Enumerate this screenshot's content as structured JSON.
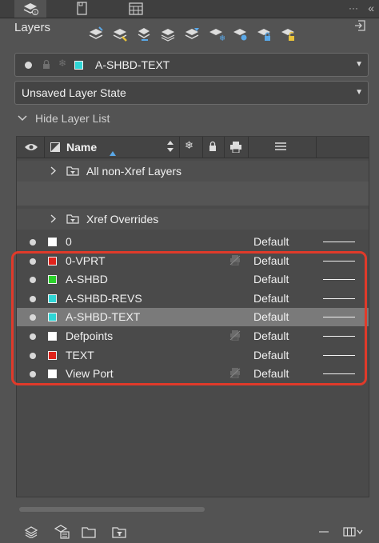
{
  "panel": {
    "title": "Layers",
    "current_layer": "A-SHBD-TEXT",
    "current_layer_color": "#2fd6d6",
    "layer_state": "Unsaved Layer State",
    "hide_list_label": "Hide Layer List",
    "overflow_glyph": "···",
    "collapse_glyph": "«"
  },
  "columns": {
    "name": "Name"
  },
  "groups": [
    {
      "label": "All non-Xref Layers"
    },
    {
      "label": "Xref Overrides"
    }
  ],
  "layers": [
    {
      "name": "0",
      "color": "#ffffff",
      "linetype": "Default",
      "no_plot": false,
      "selected": false
    },
    {
      "name": "0-VPRT",
      "color": "#e0231b",
      "linetype": "Default",
      "no_plot": true,
      "selected": false
    },
    {
      "name": "A-SHBD",
      "color": "#2bd12b",
      "linetype": "Default",
      "no_plot": false,
      "selected": false
    },
    {
      "name": "A-SHBD-REVS",
      "color": "#2fd6d6",
      "linetype": "Default",
      "no_plot": false,
      "selected": false
    },
    {
      "name": "A-SHBD-TEXT",
      "color": "#2fd6d6",
      "linetype": "Default",
      "no_plot": false,
      "selected": true
    },
    {
      "name": "Defpoints",
      "color": "#ffffff",
      "linetype": "Default",
      "no_plot": true,
      "selected": false
    },
    {
      "name": "TEXT",
      "color": "#e0231b",
      "linetype": "Default",
      "no_plot": false,
      "selected": false
    },
    {
      "name": "View Port",
      "color": "#ffffff",
      "linetype": "Default",
      "no_plot": true,
      "selected": false
    }
  ],
  "colors": {
    "highlight_border": "#e03a2a",
    "selected_row": "#7a7a7a",
    "accent_blue": "#5aa8e8"
  }
}
